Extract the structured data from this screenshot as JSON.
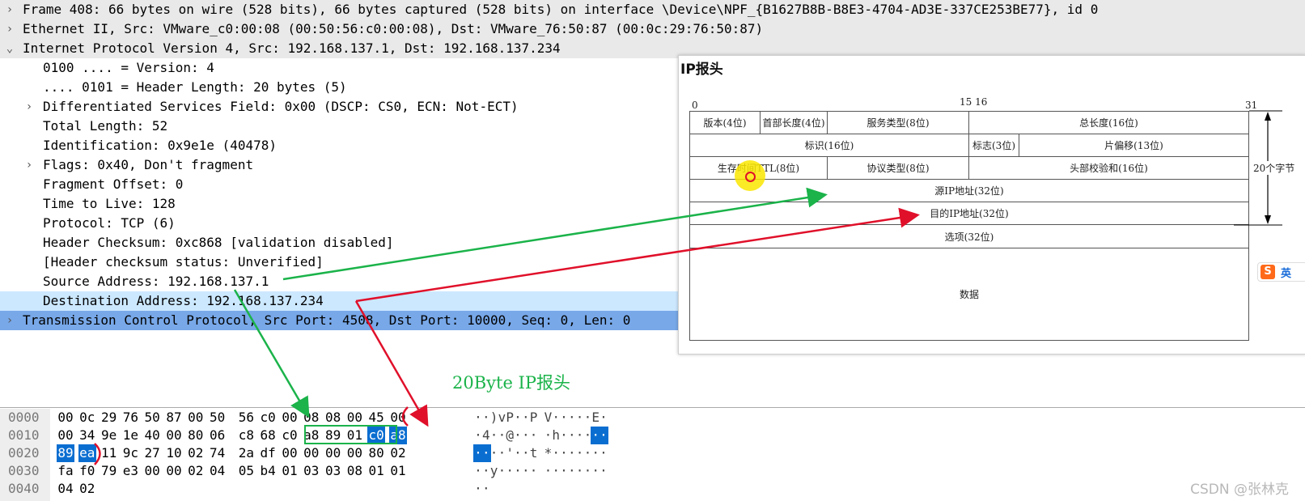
{
  "tree": [
    {
      "indent": 0,
      "arrow": ">",
      "text": "Frame 408: 66 bytes on wire (528 bits), 66 bytes captured (528 bits) on interface \\Device\\NPF_{B1627B8B-B8E3-4704-AD3E-337CE253BE77}, id 0",
      "style": "gray"
    },
    {
      "indent": 0,
      "arrow": ">",
      "text": "Ethernet II, Src: VMware_c0:00:08 (00:50:56:c0:00:08), Dst: VMware_76:50:87 (00:0c:29:76:50:87)",
      "style": "gray"
    },
    {
      "indent": 0,
      "arrow": "v",
      "text": "Internet Protocol Version 4, Src: 192.168.137.1, Dst: 192.168.137.234",
      "style": "gray"
    },
    {
      "indent": 1,
      "arrow": "",
      "text": "0100 .... = Version: 4",
      "style": ""
    },
    {
      "indent": 1,
      "arrow": "",
      "text": ".... 0101 = Header Length: 20 bytes (5)",
      "style": ""
    },
    {
      "indent": 1,
      "arrow": ">",
      "text": "Differentiated Services Field: 0x00 (DSCP: CS0, ECN: Not-ECT)",
      "style": ""
    },
    {
      "indent": 1,
      "arrow": "",
      "text": "Total Length: 52",
      "style": ""
    },
    {
      "indent": 1,
      "arrow": "",
      "text": "Identification: 0x9e1e (40478)",
      "style": ""
    },
    {
      "indent": 1,
      "arrow": ">",
      "text": "Flags: 0x40, Don't fragment",
      "style": ""
    },
    {
      "indent": 1,
      "arrow": "",
      "text": "Fragment Offset: 0",
      "style": ""
    },
    {
      "indent": 1,
      "arrow": "",
      "text": "Time to Live: 128",
      "style": ""
    },
    {
      "indent": 1,
      "arrow": "",
      "text": "Protocol: TCP (6)",
      "style": ""
    },
    {
      "indent": 1,
      "arrow": "",
      "text": "Header Checksum: 0xc868 [validation disabled]",
      "style": ""
    },
    {
      "indent": 1,
      "arrow": "",
      "text": "[Header checksum status: Unverified]",
      "style": ""
    },
    {
      "indent": 1,
      "arrow": "",
      "text": "Source Address: 192.168.137.1",
      "style": ""
    },
    {
      "indent": 1,
      "arrow": "",
      "text": "Destination Address: 192.168.137.234",
      "style": "sel-light"
    },
    {
      "indent": 0,
      "arrow": ">",
      "text": "Transmission Control Protocol, Src Port: 4508, Dst Port: 10000, Seq: 0, Len: 0",
      "style": "sel-dark"
    }
  ],
  "hex": [
    {
      "offset": "0000",
      "bytes": [
        "00",
        "0c",
        "29",
        "76",
        "50",
        "87",
        "00",
        "50",
        "56",
        "c0",
        "00",
        "08",
        "08",
        "00",
        "45",
        "00"
      ],
      "ascii": [
        "·",
        "·",
        ")",
        "v",
        "P",
        "·",
        "·",
        "P",
        "V",
        "·",
        "·",
        "·",
        "·",
        "·",
        "E",
        "·"
      ]
    },
    {
      "offset": "0010",
      "bytes": [
        "00",
        "34",
        "9e",
        "1e",
        "40",
        "00",
        "80",
        "06",
        "c8",
        "68",
        "c0",
        "a8",
        "89",
        "01",
        "c0",
        "a8"
      ],
      "ascii": [
        "·",
        "4",
        "·",
        "·",
        "@",
        "·",
        "·",
        "·",
        "·",
        "h",
        "·",
        "·",
        "·",
        "·",
        "·",
        "·"
      ]
    },
    {
      "offset": "0020",
      "bytes": [
        "89",
        "ea",
        "11",
        "9c",
        "27",
        "10",
        "02",
        "74",
        "2a",
        "df",
        "00",
        "00",
        "00",
        "00",
        "80",
        "02"
      ],
      "ascii": [
        "·",
        "·",
        "·",
        "·",
        "'",
        "·",
        "·",
        "t",
        "*",
        "·",
        "·",
        "·",
        "·",
        "·",
        "·",
        "·"
      ]
    },
    {
      "offset": "0030",
      "bytes": [
        "fa",
        "f0",
        "79",
        "e3",
        "00",
        "00",
        "02",
        "04",
        "05",
        "b4",
        "01",
        "03",
        "03",
        "08",
        "01",
        "01"
      ],
      "ascii": [
        "·",
        "·",
        "y",
        "·",
        "·",
        "·",
        "·",
        "·",
        "·",
        "·",
        "·",
        "·",
        "·",
        "·",
        "·",
        "·"
      ]
    },
    {
      "offset": "0040",
      "bytes": [
        "04",
        "02"
      ],
      "ascii": [
        "·",
        "·"
      ]
    }
  ],
  "ip_figure": {
    "title": "IP报头",
    "bit_labels": [
      "0",
      "15 16",
      "31"
    ],
    "rows": [
      [
        "版本(4位)",
        "首部长度(4位)",
        "服务类型(8位)",
        "总长度(16位)"
      ],
      [
        "标识(16位)",
        "标志(3位)",
        "片偏移(13位)"
      ],
      [
        "生存时间TTL(8位)",
        "协议类型(8位)",
        "头部校验和(16位)"
      ],
      [
        "源IP地址(32位)"
      ],
      [
        "目的IP地址(32位)"
      ],
      [
        "选项(32位)"
      ],
      [
        "数据"
      ]
    ],
    "side_note": "20个字节",
    "ime_label": "英"
  },
  "annotation": "20Byte IP报头",
  "watermark": "CSDN @张林克",
  "colors": {
    "selection_dark": "#0a6ed1",
    "row_light": "#cce8ff",
    "row_dark": "#78a8e8",
    "arrow_green": "#1bb34a",
    "arrow_red": "#e0102a"
  }
}
